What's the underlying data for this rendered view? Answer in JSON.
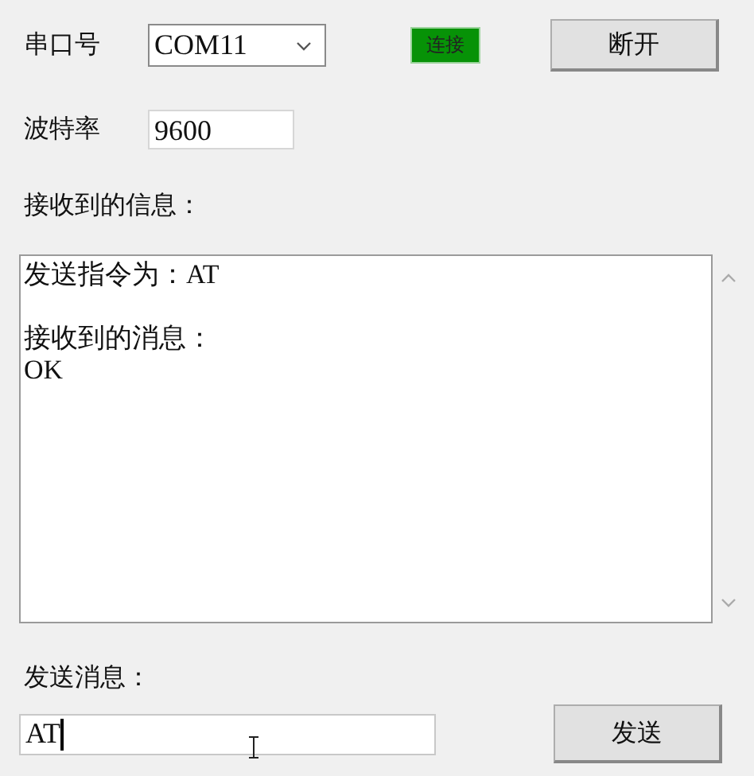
{
  "port": {
    "label": "串口号",
    "value": "COM11"
  },
  "connection": {
    "label": "连接",
    "on": true
  },
  "disconnect_button": "断开",
  "baud": {
    "label": "波特率",
    "value": "9600"
  },
  "received_label": "接收到的信息：",
  "log": [
    {
      "lines": [
        "发送指令为：AT"
      ]
    },
    {
      "lines": [
        "接收到的消息：",
        "OK"
      ]
    }
  ],
  "send_label": "发送消息：",
  "send_field": {
    "value": "AT"
  },
  "send_button": "发送"
}
